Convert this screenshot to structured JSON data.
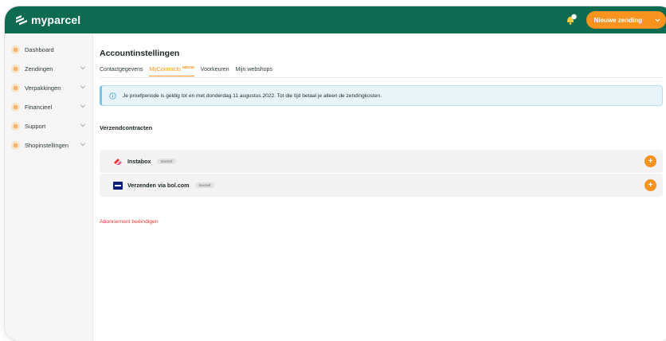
{
  "app": {
    "logo_text": "myparcel"
  },
  "topbar": {
    "new_shipment_label": "Nieuwe zending"
  },
  "sidebar": {
    "items": [
      {
        "label": "Dashboard"
      },
      {
        "label": "Zendingen"
      },
      {
        "label": "Verpakkingen"
      },
      {
        "label": "Financieel"
      },
      {
        "label": "Support"
      },
      {
        "label": "Shopinstellingen"
      }
    ]
  },
  "page": {
    "title": "Accountinstellingen",
    "tabs": [
      {
        "label": "Contactgegevens"
      },
      {
        "label": "MyContracts",
        "badge": "NIEUW"
      },
      {
        "label": "Voorkeuren"
      },
      {
        "label": "Mijn webshops"
      }
    ],
    "info_message": "Je proefperiode is geldig tot en met donderdag 11 augustus 2022. Tot die tijd betaal je alleen de zendingkosten.",
    "section_title": "Verzendcontracten",
    "contracts": [
      {
        "name": "Instabox",
        "status": "Inactief"
      },
      {
        "name": "Verzenden via bol.com",
        "status": "Inactief"
      }
    ],
    "cancel_label": "Abonnement beëindigen"
  },
  "colors": {
    "brand_green": "#0e6b51",
    "accent_orange": "#f7931e",
    "danger_red": "#e53935"
  }
}
